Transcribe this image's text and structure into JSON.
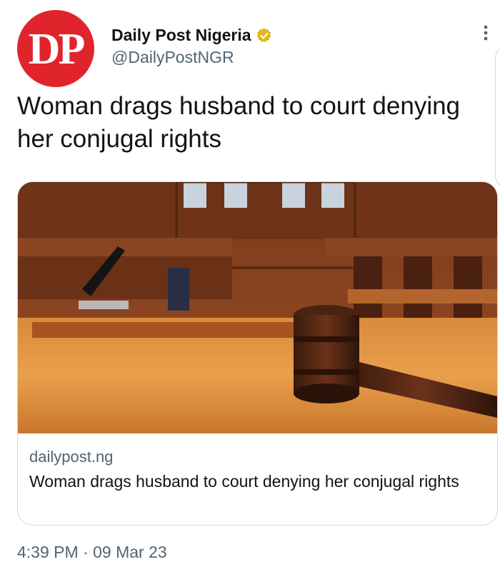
{
  "author": {
    "avatar_text": "DP",
    "display_name": "Daily Post Nigeria",
    "handle": "@DailyPostNGR",
    "verified_color": "#e2b719"
  },
  "tweet": {
    "text": "Woman drags husband to court denying her conjugal rights",
    "timestamp": "4:39 PM · 09 Mar 23"
  },
  "link_card": {
    "image_subject": "courtroom-gavel-image",
    "domain": "dailypost.ng",
    "title": "Woman drags husband to court denying her conjugal rights"
  },
  "colors": {
    "avatar_bg": "#e0242b",
    "text_primary": "#0f1419",
    "text_secondary": "#536471",
    "border": "#cfd9de"
  }
}
